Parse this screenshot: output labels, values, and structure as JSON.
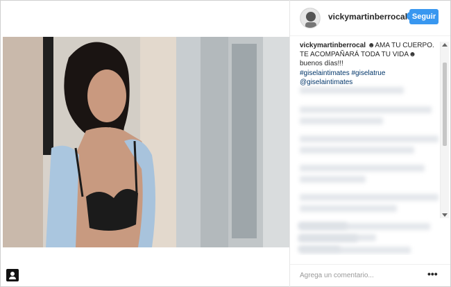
{
  "post": {
    "username": "vickymartinberrocal",
    "verified_icon": "verified-check-icon",
    "follow_label": "Seguir",
    "caption_user": "vickymartinberrocal",
    "caption_text": " ☻AMA TU CUERPO. TE ACOMPAÑARÁ TODA TU VIDA☻buenos días!!!",
    "tags": [
      "#giselaintimates",
      "#giselatrue",
      "@giselaintimates"
    ]
  },
  "comment_box": {
    "placeholder": "Agrega un comentario...",
    "more_label": "•••"
  },
  "colors": {
    "accent": "#3897f0",
    "link": "#003569"
  }
}
